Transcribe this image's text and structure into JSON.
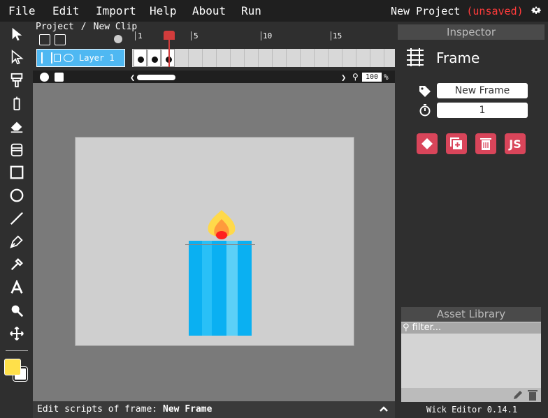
{
  "menu": {
    "items": [
      "File",
      "Edit",
      "Import",
      "Help",
      "About",
      "Run"
    ]
  },
  "project": {
    "name": "New Project",
    "status": "(unsaved)"
  },
  "timeline": {
    "breadcrumb": [
      "Project",
      "/",
      "New Clip"
    ],
    "ruler_labels": [
      "1",
      "5",
      "10",
      "15"
    ],
    "layer_name": "Layer 1",
    "filled_frames": 3,
    "playhead_frame": 3,
    "zoom_value": "100",
    "zoom_unit": "%"
  },
  "inspector": {
    "header": "Inspector",
    "object_type": "Frame",
    "frame_name": "New Frame",
    "frame_length": "1",
    "js_label": "JS"
  },
  "asset_library": {
    "header": "Asset Library",
    "filter_placeholder": "filter..."
  },
  "scriptbar": {
    "label": "Edit scripts of frame:",
    "frame_name": "New Frame"
  },
  "footer": {
    "version": "Wick Editor 0.14.1"
  },
  "colors": {
    "fill": "#ffe04a",
    "stroke": "#ffffff",
    "accent": "#d9455a",
    "layer": "#4fb8f2",
    "playhead": "#d23c3c"
  },
  "tools": [
    "cursor-icon",
    "select-icon",
    "brush-icon",
    "pencil-icon",
    "eraser-icon",
    "fill-bucket-icon",
    "rectangle-icon",
    "ellipse-icon",
    "line-icon",
    "pen-icon",
    "eyedropper-icon",
    "text-icon",
    "zoom-icon",
    "pan-icon"
  ]
}
